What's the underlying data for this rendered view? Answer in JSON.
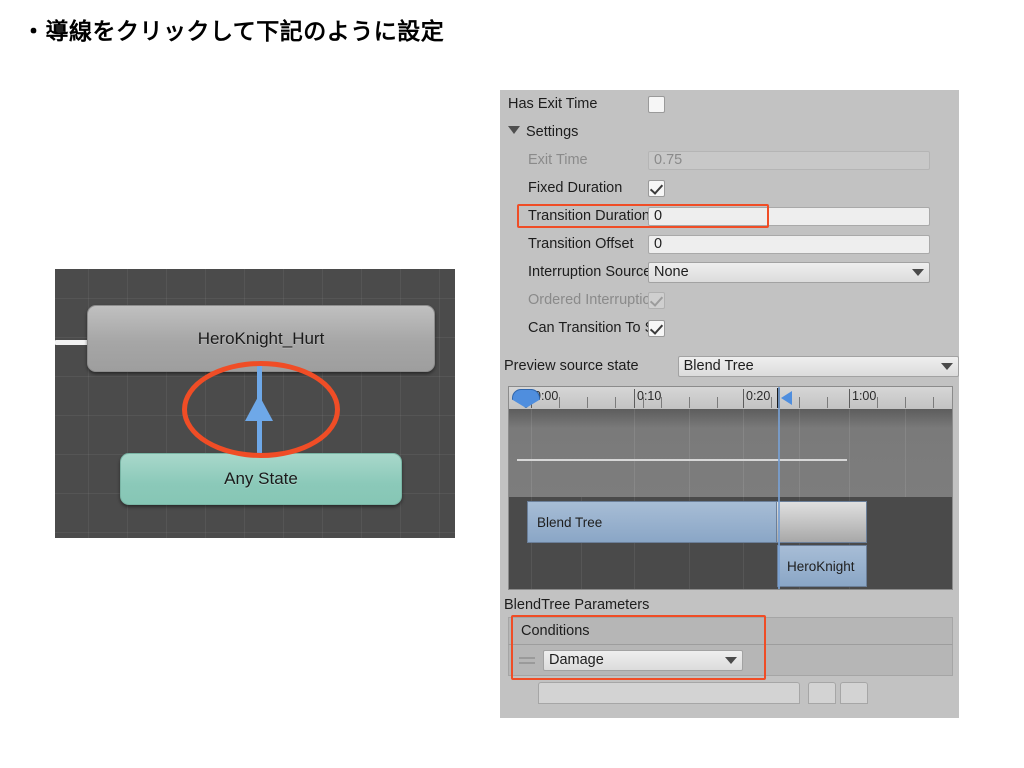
{
  "slide": {
    "heading": "・導線をクリックして下記のように設定"
  },
  "graph": {
    "nodes": [
      {
        "name": "HeroKnight_Hurt",
        "type": "state"
      },
      {
        "name": "Any State",
        "type": "any-state"
      }
    ],
    "annotation": "red-ellipse-highlight-on-transition-arrow"
  },
  "inspector": {
    "rows": [
      {
        "label": "Has Exit Time",
        "control": "checkbox",
        "checked": false,
        "disabled": false
      },
      {
        "label": "Settings",
        "control": "foldout",
        "expanded": true
      },
      {
        "label": "Exit Time",
        "control": "field",
        "value": "0.75",
        "disabled": true
      },
      {
        "label": "Fixed Duration",
        "control": "checkbox",
        "checked": true,
        "disabled": false
      },
      {
        "label": "Transition Duration",
        "control": "field",
        "value": "0",
        "disabled": false,
        "highlighted": true
      },
      {
        "label": "Transition Offset",
        "control": "field",
        "value": "0",
        "disabled": false
      },
      {
        "label": "Interruption Source",
        "control": "popup",
        "value": "None",
        "disabled": false
      },
      {
        "label": "Ordered Interruption",
        "control": "checkbox",
        "checked": true,
        "disabled": true
      },
      {
        "label": "Can Transition To Self",
        "control": "checkbox",
        "checked": true,
        "disabled": false
      }
    ],
    "preview_source_state": {
      "label": "Preview source state",
      "value": "Blend Tree"
    },
    "timeline": {
      "tick_labels": [
        "0:00",
        "0:10",
        "0:20",
        "1:00"
      ],
      "clips": [
        {
          "name": "Blend Tree",
          "style": "blue"
        },
        {
          "name": "HeroKnight",
          "style": "blue"
        }
      ]
    },
    "blendtree_parameters_label": "BlendTree Parameters",
    "conditions": {
      "header": "Conditions",
      "rows": [
        {
          "parameter": "Damage",
          "operator_glyph": "drag-handle"
        }
      ],
      "highlighted": true
    }
  },
  "colors": {
    "highlight": "#f04d26",
    "any_state": "#8bc9b9",
    "state_node": "#a6a6a6",
    "transition_arrow": "#6ea8e8",
    "inspector_bg": "#c2c2c2",
    "graph_bg": "#4b4b4b",
    "clip_blue": "#8aa6c6"
  }
}
